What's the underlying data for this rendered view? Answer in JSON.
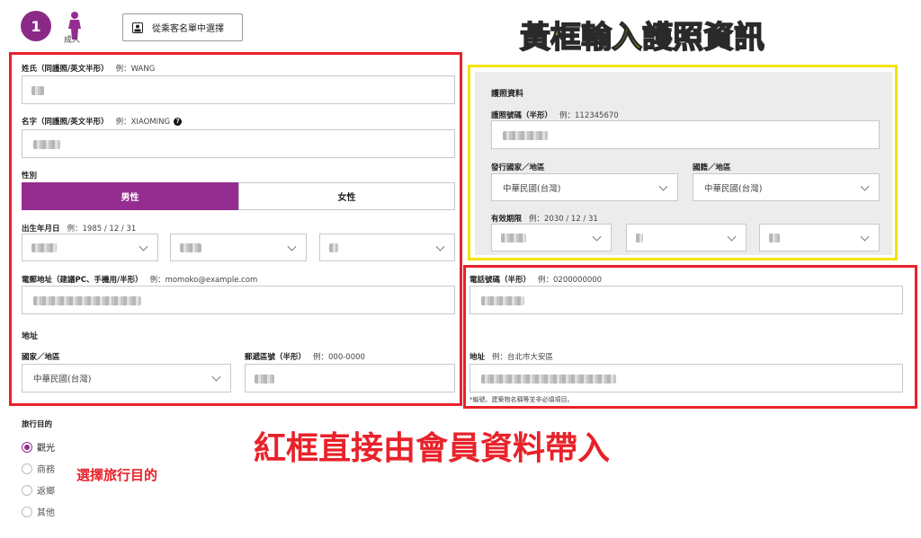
{
  "header": {
    "step_number": "1",
    "passenger_type": "成人",
    "pick_button": "從乘客名單中選擇"
  },
  "annotations": {
    "yellow_note": "黃框輸入護照資訊",
    "red_note": "紅框直接由會員資料帶入",
    "purpose_note": "選擇旅行目的"
  },
  "personal": {
    "surname_label": "姓氏（同護照/英文半形）",
    "surname_example": "例：WANG",
    "given_label": "名字（同護照/英文半形）",
    "given_example": "例：XIAOMING",
    "gender_label": "性別",
    "gender_male": "男性",
    "gender_female": "女性",
    "dob_label": "出生年月日",
    "dob_example": "例：1985 / 12 / 31",
    "email_label": "電郵地址（建議PC、手機用/半形）",
    "email_example": "例：momoko@example.com",
    "address_head": "地址",
    "country_label": "國家／地區",
    "country_value": "中華民國(台灣)",
    "zip_label": "郵遞區號（半形）",
    "zip_example": "例：000-0000"
  },
  "passport": {
    "section_title": "護照資料",
    "number_label": "護照號碼（半形）",
    "number_example": "例：112345670",
    "issue_country_label": "發行國家／地區",
    "issue_country_value": "中華民國(台灣)",
    "nationality_label": "國籍／地區",
    "nationality_value": "中華民國(台灣)",
    "expiry_label": "有效期限",
    "expiry_example": "例：2030 / 12 / 31"
  },
  "contact": {
    "phone_label": "電話號碼（半形）",
    "phone_example": "例：0200000000",
    "addr_label": "地址",
    "addr_example": "例：台北市大安區",
    "addr_note": "*編號、建築物名稱等並非必填項目。"
  },
  "purpose": {
    "label": "旅行目的",
    "options": [
      "觀光",
      "商務",
      "返鄉",
      "其他"
    ],
    "selected": "觀光"
  },
  "colors": {
    "brand": "#952d90",
    "red_frame": "#e8222a",
    "yellow_frame": "#f2e200"
  }
}
